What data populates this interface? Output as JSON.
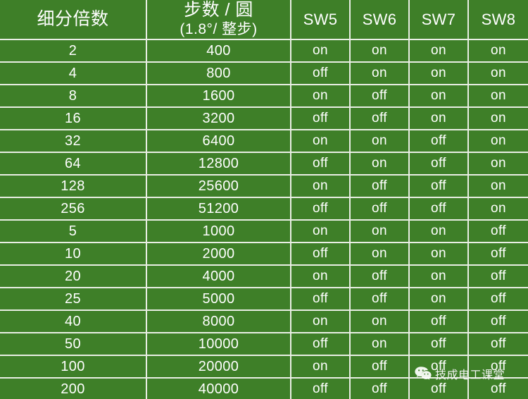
{
  "table": {
    "headers": {
      "ratio": "细分倍数",
      "steps_line1": "步数 / 圆",
      "steps_line2": "(1.8°/ 整步)",
      "sw5": "SW5",
      "sw6": "SW6",
      "sw7": "SW7",
      "sw8": "SW8"
    },
    "rows": [
      {
        "ratio": "2",
        "steps": "400",
        "sw5": "on",
        "sw6": "on",
        "sw7": "on",
        "sw8": "on"
      },
      {
        "ratio": "4",
        "steps": "800",
        "sw5": "off",
        "sw6": "on",
        "sw7": "on",
        "sw8": "on"
      },
      {
        "ratio": "8",
        "steps": "1600",
        "sw5": "on",
        "sw6": "off",
        "sw7": "on",
        "sw8": "on"
      },
      {
        "ratio": "16",
        "steps": "3200",
        "sw5": "off",
        "sw6": "off",
        "sw7": "on",
        "sw8": "on"
      },
      {
        "ratio": "32",
        "steps": "6400",
        "sw5": "on",
        "sw6": "on",
        "sw7": "off",
        "sw8": "on"
      },
      {
        "ratio": "64",
        "steps": "12800",
        "sw5": "off",
        "sw6": "on",
        "sw7": "off",
        "sw8": "on"
      },
      {
        "ratio": "128",
        "steps": "25600",
        "sw5": "on",
        "sw6": "off",
        "sw7": "off",
        "sw8": "on"
      },
      {
        "ratio": "256",
        "steps": "51200",
        "sw5": "off",
        "sw6": "off",
        "sw7": "off",
        "sw8": "on"
      },
      {
        "ratio": "5",
        "steps": "1000",
        "sw5": "on",
        "sw6": "on",
        "sw7": "on",
        "sw8": "off"
      },
      {
        "ratio": "10",
        "steps": "2000",
        "sw5": "off",
        "sw6": "on",
        "sw7": "on",
        "sw8": "off"
      },
      {
        "ratio": "20",
        "steps": "4000",
        "sw5": "on",
        "sw6": "off",
        "sw7": "on",
        "sw8": "off"
      },
      {
        "ratio": "25",
        "steps": "5000",
        "sw5": "off",
        "sw6": "off",
        "sw7": "on",
        "sw8": "off"
      },
      {
        "ratio": "40",
        "steps": "8000",
        "sw5": "on",
        "sw6": "on",
        "sw7": "off",
        "sw8": "off"
      },
      {
        "ratio": "50",
        "steps": "10000",
        "sw5": "off",
        "sw6": "on",
        "sw7": "off",
        "sw8": "off"
      },
      {
        "ratio": "100",
        "steps": "20000",
        "sw5": "on",
        "sw6": "off",
        "sw7": "off",
        "sw8": "off"
      },
      {
        "ratio": "200",
        "steps": "40000",
        "sw5": "off",
        "sw6": "off",
        "sw7": "off",
        "sw8": "off"
      }
    ]
  },
  "watermark": {
    "text": "技成电工课堂",
    "icon": "wechat-icon"
  },
  "colors": {
    "cell_green": "#3e7f28",
    "grid_line": "#e9eee4",
    "text": "#ffffff"
  }
}
